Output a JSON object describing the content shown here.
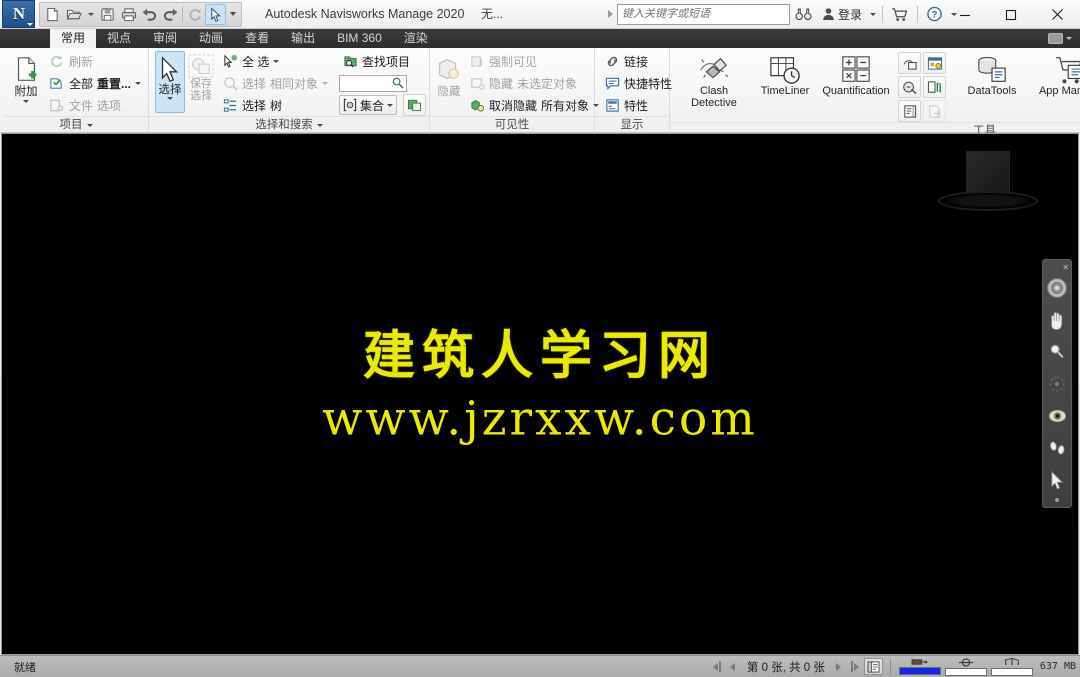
{
  "window": {
    "app_title": "Autodesk Navisworks Manage 2020",
    "document_title": "无...",
    "app_button_letter": "N",
    "minimize_label": "最小化",
    "maximize_label": "最大化",
    "close_label": "关闭"
  },
  "quick_access": {
    "items": [
      {
        "name": "new-icon",
        "label": "新建"
      },
      {
        "name": "open-icon",
        "label": "打开"
      },
      {
        "name": "save-icon",
        "label": "保存"
      },
      {
        "name": "print-icon",
        "label": "打印"
      },
      {
        "name": "undo-icon",
        "label": "放弃"
      },
      {
        "name": "redo-icon",
        "label": "重做"
      },
      {
        "name": "refresh-icon",
        "label": "刷新"
      },
      {
        "name": "select-icon",
        "label": "选择"
      }
    ]
  },
  "infocenter": {
    "search_placeholder": "键入关键字或短语",
    "search_value": "",
    "binoculars_label": "搜索",
    "signin_label": "登录",
    "cart_label": "Autodesk App Store",
    "help_label": "帮助"
  },
  "ribbon": {
    "tabs": [
      {
        "label": "常用",
        "active": true
      },
      {
        "label": "视点",
        "active": false
      },
      {
        "label": "审阅",
        "active": false
      },
      {
        "label": "动画",
        "active": false
      },
      {
        "label": "查看",
        "active": false
      },
      {
        "label": "输出",
        "active": false
      },
      {
        "label": "BIM 360",
        "active": false
      },
      {
        "label": "渲染",
        "active": false
      }
    ],
    "panels": {
      "project": {
        "label": "项目",
        "attach": "附加",
        "refresh": "刷新",
        "reset_all_a": "全部",
        "reset_all_b": "重置...",
        "file_options_a": "文件",
        "file_options_b": "选项"
      },
      "select_search": {
        "label": "选择和搜索",
        "select": "选择",
        "save_selection_a": "保存",
        "save_selection_b": "选择",
        "select_all": "全 选",
        "select_same_a": "选择",
        "select_same_b": "相同对象",
        "selection_tree_a": "选择",
        "selection_tree_b": "树",
        "find_items": "查找项目",
        "find_value": "",
        "sets": "集合"
      },
      "visibility": {
        "label": "可见性",
        "hide": "隐藏",
        "require": "强制可见",
        "hide_unselected_a": "隐藏",
        "hide_unselected_b": "未选定对象",
        "unhide_all_a": "取消隐藏",
        "unhide_all_b": "所有对象"
      },
      "display": {
        "label": "显示",
        "links": "链接",
        "quick_properties": "快捷特性",
        "properties": "特性"
      },
      "tools": {
        "label": "工具",
        "clash_a": "Clash",
        "clash_b": "Detective",
        "timeliner": "TimeLiner",
        "quantification": "Quantification",
        "datatools": "DataTools",
        "app_manager": "App Manager"
      }
    }
  },
  "viewport": {
    "watermark_line1": "建筑人学习网",
    "watermark_line2": "www.jzrxxw.com",
    "watermark_color": "#eaea00",
    "background_color": "#000000",
    "viewcube_label": "ViewCube",
    "navbar": [
      {
        "name": "steering-wheel-icon",
        "label": "SteeringWheels"
      },
      {
        "name": "pan-hand-icon",
        "label": "平移"
      },
      {
        "name": "zoom-magnifier-icon",
        "label": "缩放"
      },
      {
        "name": "orbit-icon",
        "label": "动态观察"
      },
      {
        "name": "look-eye-icon",
        "label": "环视"
      },
      {
        "name": "walk-footprints-icon",
        "label": "漫游"
      },
      {
        "name": "select-arrow-icon",
        "label": "选择"
      }
    ]
  },
  "status_bar": {
    "ready_text": "就绪",
    "sheet_counter": "第 0 张, 共 0 张",
    "memory_text": "637 MB",
    "meters": [
      {
        "name": "drawing-meter",
        "percent": 100
      },
      {
        "name": "render-meter",
        "percent": 0
      },
      {
        "name": "web-meter",
        "percent": 0
      }
    ]
  }
}
